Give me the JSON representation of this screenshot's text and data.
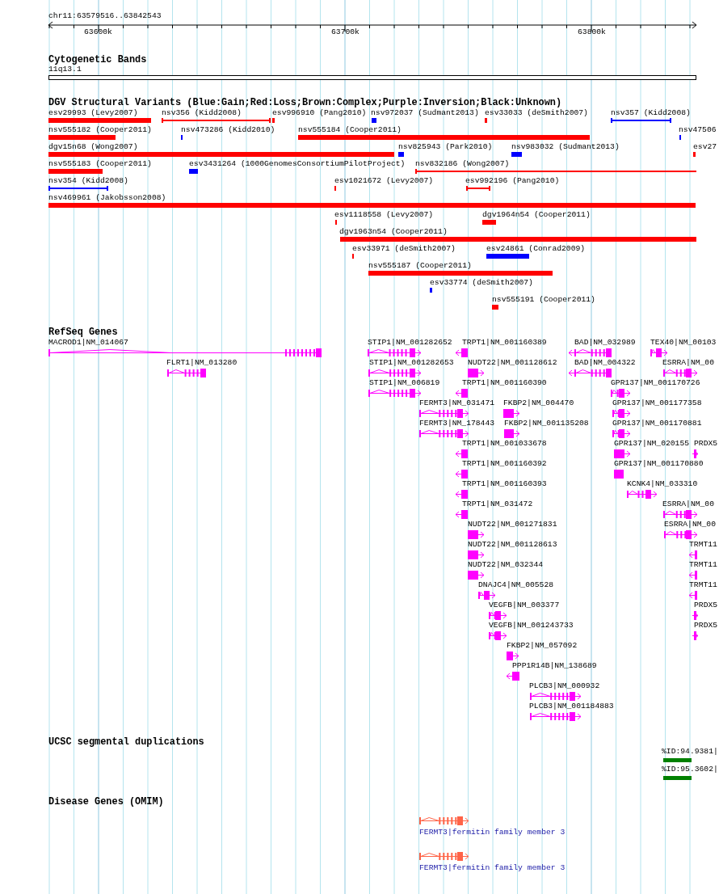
{
  "location": "chr11:63579516..63842543",
  "ruler": {
    "ticks": [
      "63600k",
      "63700k",
      "63800k"
    ]
  },
  "cytogenetic_bands": {
    "title": "Cytogenetic Bands",
    "band": "11q13.1"
  },
  "dgv": {
    "title": "DGV Structural Variants (Blue:Gain;Red:Loss;Brown:Complex;Purple:Inversion;Black:Unknown)",
    "items": [
      {
        "label": "esv29993 (Levy2007)",
        "color": "#ff0000",
        "kind": "bar"
      },
      {
        "label": "nsv356 (Kidd2008)",
        "color": "#ff0000",
        "kind": "span"
      },
      {
        "label": "esv996910 (Pang2010)",
        "color": "#ff0000",
        "kind": "bar"
      },
      {
        "label": "nsv972037 (Sudmant2013)",
        "color": "#0000ff",
        "kind": "bar"
      },
      {
        "label": "esv33033 (deSmith2007)",
        "color": "#ff0000",
        "kind": "bar"
      },
      {
        "label": "nsv357 (Kidd2008)",
        "color": "#0000ff",
        "kind": "span"
      },
      {
        "label": "nsv555182 (Cooper2011)",
        "color": "#ff0000",
        "kind": "bar"
      },
      {
        "label": "nsv473286 (Kidd2010)",
        "color": "#0000ff",
        "kind": "bar"
      },
      {
        "label": "nsv555184 (Cooper2011)",
        "color": "#ff0000",
        "kind": "bar"
      },
      {
        "label": "nsv47506",
        "color": "#0000ff",
        "kind": "bar"
      },
      {
        "label": "dgv15n68 (Wong2007)",
        "color": "#ff0000",
        "kind": "bar"
      },
      {
        "label": "nsv825943 (Park2010)",
        "color": "#0000ff",
        "kind": "bar"
      },
      {
        "label": "nsv983032 (Sudmant2013)",
        "color": "#0000ff",
        "kind": "bar"
      },
      {
        "label": "esv27",
        "color": "#ff0000",
        "kind": "bar"
      },
      {
        "label": "nsv555183 (Cooper2011)",
        "color": "#ff0000",
        "kind": "bar"
      },
      {
        "label": "esv3431264 (1000GenomesConsortiumPilotProject)",
        "color": "#0000ff",
        "kind": "bar"
      },
      {
        "label": "nsv832186 (Wong2007)",
        "color": "#ff0000",
        "kind": "span"
      },
      {
        "label": "nsv354 (Kidd2008)",
        "color": "#0000ff",
        "kind": "span"
      },
      {
        "label": "esv1021672 (Levy2007)",
        "color": "#ff0000",
        "kind": "bar"
      },
      {
        "label": "esv992196 (Pang2010)",
        "color": "#ff0000",
        "kind": "span"
      },
      {
        "label": "nsv469961 (Jakobsson2008)",
        "color": "#ff0000",
        "kind": "bar"
      },
      {
        "label": "esv1118558 (Levy2007)",
        "color": "#ff0000",
        "kind": "bar"
      },
      {
        "label": "dgv1964n54 (Cooper2011)",
        "color": "#ff0000",
        "kind": "bar"
      },
      {
        "label": "dgv1963n54 (Cooper2011)",
        "color": "#ff0000",
        "kind": "bar"
      },
      {
        "label": "esv33971 (deSmith2007)",
        "color": "#ff0000",
        "kind": "bar"
      },
      {
        "label": "esv24861 (Conrad2009)",
        "color": "#0000ff",
        "kind": "bar"
      },
      {
        "label": "nsv555187 (Cooper2011)",
        "color": "#ff0000",
        "kind": "bar"
      },
      {
        "label": "esv33774 (deSmith2007)",
        "color": "#0000ff",
        "kind": "bar"
      },
      {
        "label": "nsv555191 (Cooper2011)",
        "color": "#ff0000",
        "kind": "bar"
      }
    ]
  },
  "refseq": {
    "title": "RefSeq Genes",
    "genes": [
      {
        "label": "MACROD1|NM_014067"
      },
      {
        "label": "STIP1|NM_001282652"
      },
      {
        "label": "TRPT1|NM_001160389"
      },
      {
        "label": "BAD|NM_032989"
      },
      {
        "label": "TEX40|NM_00103"
      },
      {
        "label": "FLRT1|NM_013280"
      },
      {
        "label": "STIP1|NM_001282653"
      },
      {
        "label": "NUDT22|NM_001128612"
      },
      {
        "label": "BAD|NM_004322"
      },
      {
        "label": "ESRRA|NM_00"
      },
      {
        "label": "STIP1|NM_006819"
      },
      {
        "label": "TRPT1|NM_001160390"
      },
      {
        "label": "GPR137|NM_001170726"
      },
      {
        "label": "FERMT3|NM_031471"
      },
      {
        "label": "FKBP2|NM_004470"
      },
      {
        "label": "GPR137|NM_001177358"
      },
      {
        "label": "FERMT3|NM_178443"
      },
      {
        "label": "FKBP2|NM_001135208"
      },
      {
        "label": "GPR137|NM_001170881"
      },
      {
        "label": "TRPT1|NM_001033678"
      },
      {
        "label": "GPR137|NM_020155"
      },
      {
        "label": "PRDX5"
      },
      {
        "label": "TRPT1|NM_001160392"
      },
      {
        "label": "GPR137|NM_001170880"
      },
      {
        "label": "TRPT1|NM_001160393"
      },
      {
        "label": "KCNK4|NM_033310"
      },
      {
        "label": "TRPT1|NM_031472"
      },
      {
        "label": "ESRRA|NM_00"
      },
      {
        "label": "NUDT22|NM_001271831"
      },
      {
        "label": "ESRRA|NM_00"
      },
      {
        "label": "NUDT22|NM_001128613"
      },
      {
        "label": "TRMT11"
      },
      {
        "label": "NUDT22|NM_032344"
      },
      {
        "label": "TRMT11"
      },
      {
        "label": "DNAJC4|NM_005528"
      },
      {
        "label": "TRMT11"
      },
      {
        "label": "VEGFB|NM_003377"
      },
      {
        "label": "PRDX5"
      },
      {
        "label": "VEGFB|NM_001243733"
      },
      {
        "label": "PRDX5"
      },
      {
        "label": "FKBP2|NM_057092"
      },
      {
        "label": "PPP1R14B|NM_138689"
      },
      {
        "label": "PLCB3|NM_000932"
      },
      {
        "label": "PLCB3|NM_001184883"
      }
    ]
  },
  "segmental_duplications": {
    "title": "UCSC segmental duplications",
    "items": [
      {
        "label": "%ID:94.9381|"
      },
      {
        "label": "%ID:95.3602|"
      }
    ]
  },
  "omim": {
    "title": "Disease Genes (OMIM)",
    "items": [
      {
        "label": "FERMT3|fermitin family member 3"
      },
      {
        "label": "FERMT3|fermitin family member 3"
      }
    ]
  }
}
